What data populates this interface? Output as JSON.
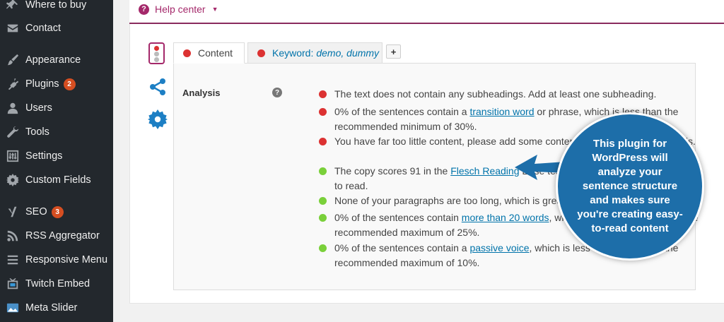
{
  "sidebar": {
    "items": [
      {
        "label": "Where to buy",
        "icon": "pin-icon"
      },
      {
        "label": "Contact",
        "icon": "envelope-icon"
      },
      {
        "label": "Appearance",
        "icon": "paintbrush-icon"
      },
      {
        "label": "Plugins",
        "icon": "plug-icon",
        "badge": "2"
      },
      {
        "label": "Users",
        "icon": "user-icon"
      },
      {
        "label": "Tools",
        "icon": "wrench-icon"
      },
      {
        "label": "Settings",
        "icon": "sliders-icon"
      },
      {
        "label": "Custom Fields",
        "icon": "gear-icon"
      },
      {
        "label": "SEO",
        "icon": "yoast-icon",
        "badge": "3"
      },
      {
        "label": "RSS Aggregator",
        "icon": "rss-icon"
      },
      {
        "label": "Responsive Menu",
        "icon": "hamburger-icon"
      },
      {
        "label": "Twitch Embed",
        "icon": "tv-icon"
      },
      {
        "label": "Meta Slider",
        "icon": "image-icon"
      }
    ]
  },
  "help": {
    "label": "Help center"
  },
  "tabs": {
    "content_label": "Content",
    "keyword_label": "Keyword:",
    "keyword_value": "demo, dummy",
    "add_label": "+"
  },
  "analysis": {
    "label": "Analysis",
    "help_glyph": "?",
    "results": [
      {
        "status": "bad",
        "pre": "The text does not contain any subheadings. Add at least one subheading.",
        "link": "",
        "post": ""
      },
      {
        "status": "bad",
        "pre": "0% of the sentences contain a ",
        "link": "transition word",
        "post": " or phrase, which is less than the recommended minimum of 30%."
      },
      {
        "status": "bad",
        "pre": "You have far too little content, please add some content to enable a good analysis.",
        "link": "",
        "post": ""
      },
      {
        "status": "good",
        "pre": "The copy scores 91 in the ",
        "link": "Flesch Reading",
        "post": " Ease test, which is considered very easy to read."
      },
      {
        "status": "good",
        "pre": "None of your paragraphs are too long, which is great.",
        "link": "",
        "post": ""
      },
      {
        "status": "good",
        "pre": "0% of the sentences contain ",
        "link": "more than 20 words",
        "post": ", which is less than or equal to the recommended maximum of 25%."
      },
      {
        "status": "good",
        "pre": "0% of the sentences contain a ",
        "link": "passive voice",
        "post": ", which is less than or equal to the recommended maximum of 10%."
      }
    ]
  },
  "callout": {
    "text": "This plugin for WordPress will analyze your sentence structure and makes sure you're creating easy-to-read content"
  },
  "colors": {
    "sidebar_bg": "#23282d",
    "badge": "#d54e21",
    "bad": "#dc3232",
    "good": "#7ad03a",
    "link": "#0073aa",
    "brand": "#a4286a",
    "callout": "#1d6ea9"
  }
}
